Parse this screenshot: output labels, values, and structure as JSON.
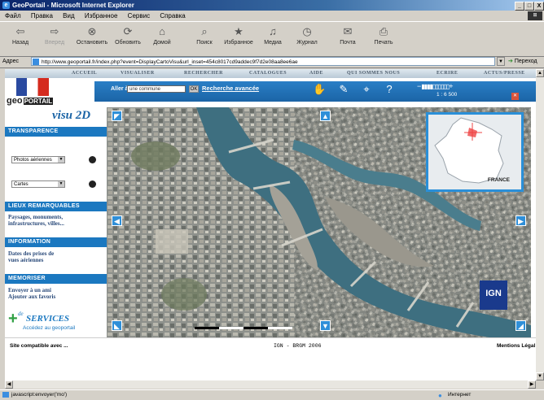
{
  "window": {
    "title": "GeoPortail - Microsoft Internet Explorer",
    "controls": [
      "_",
      "□",
      "X"
    ]
  },
  "menu": [
    "Файл",
    "Правка",
    "Вид",
    "Избранное",
    "Сервис",
    "Справка"
  ],
  "toolbar": {
    "buttons": [
      {
        "label": "Назад",
        "icon": "back-icon",
        "enabled": true
      },
      {
        "label": "Вперед",
        "icon": "forward-icon",
        "enabled": false
      },
      {
        "label": "Остановить",
        "icon": "stop-icon",
        "enabled": true
      },
      {
        "label": "Обновить",
        "icon": "refresh-icon",
        "enabled": true
      },
      {
        "label": "Домой",
        "icon": "home-icon",
        "enabled": true
      },
      {
        "label": "Поиск",
        "icon": "search-icon",
        "enabled": true
      },
      {
        "label": "Избранное",
        "icon": "favorites-icon",
        "enabled": true
      },
      {
        "label": "Медиа",
        "icon": "media-icon",
        "enabled": true
      },
      {
        "label": "Журнал",
        "icon": "history-icon",
        "enabled": true
      },
      {
        "label": "Почта",
        "icon": "mail-icon",
        "enabled": true
      },
      {
        "label": "Печать",
        "icon": "print-icon",
        "enabled": true
      }
    ]
  },
  "address": {
    "label": "Адрес",
    "url": "http://www.geoportail.fr/index.php?event=DisplayCartoVisu&url_inset=454c8017cd9addec9f7d2e08aa8ee6ae",
    "go_label": "Переход"
  },
  "nav": [
    "ACCUEIL",
    "VISUALISER",
    "RECHERCHER",
    "CATALOGUES",
    "AIDE",
    "QUI SOMMES NOUS",
    "ECRIRE",
    "ACTUS/PRESSE"
  ],
  "header": {
    "logo_text": "geo",
    "logo_badge": "PORTAIL",
    "aller_label": "Aller à",
    "aller_value": "une commune",
    "ok_label": "OK",
    "advanced_search": "Recherche avancée",
    "scale": "1 : 6 500",
    "zoom_minus": "−",
    "zoom_plus": "+"
  },
  "sidebar": {
    "title": "visu 2D",
    "transparence": {
      "heading": "TRANSPARENCE",
      "layer1": "Photos aériennes",
      "layer2": "Cartes"
    },
    "lieux": {
      "heading": "LIEUX REMARQUABLES",
      "text1": "Paysages, monuments,",
      "text2": "infrastructures, villes..."
    },
    "information": {
      "heading": "INFORMATION",
      "text1": "Dates des prises de",
      "text2": "vues aériennes"
    },
    "memoriser": {
      "heading": "MEMORISER",
      "text1": "Envoyer à un ami",
      "text2": "Ajouter aux favoris"
    },
    "services": {
      "prefix": "de",
      "title": "SERVICES",
      "subtitle": "Accédez au geoportail"
    }
  },
  "map": {
    "inset_label": "FRANCE",
    "logo": "IGN"
  },
  "footer": {
    "left": "Site compatible avec ...",
    "middle": "IGN - BRGM 2006",
    "right": "Mentions Légal"
  },
  "status": {
    "left": "javascript:envoyer('mo')",
    "right": "Интернет"
  },
  "colors": {
    "accent": "#1b78c0",
    "header_bar": "#1b64a6",
    "water": "#3e6f80"
  }
}
